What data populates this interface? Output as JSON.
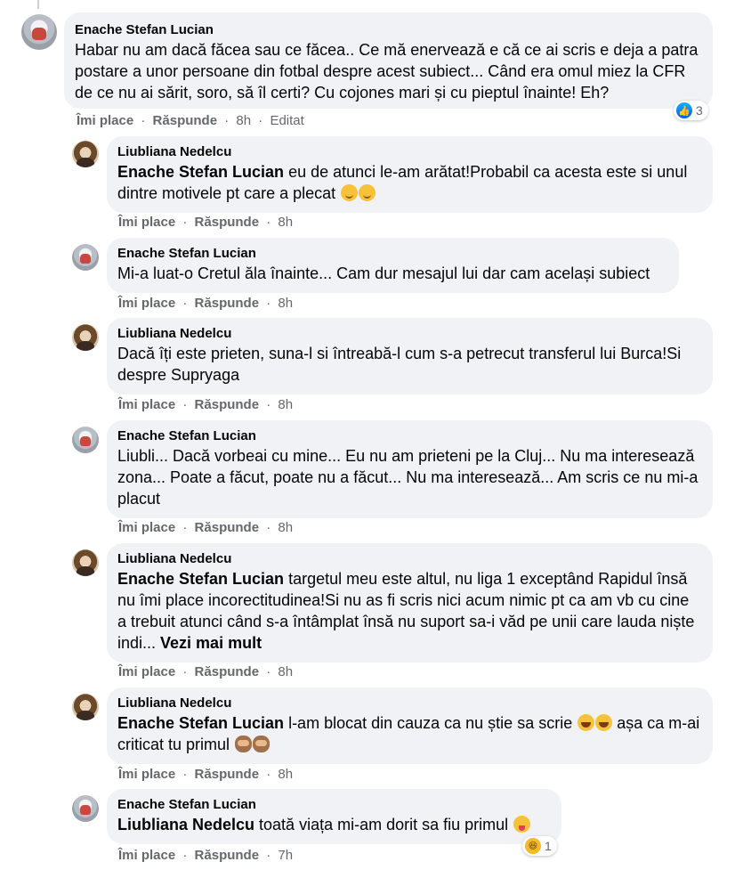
{
  "comments": [
    {
      "author": "Enache Stefan Lucian",
      "text": "Habar nu am dacă făcea sau ce făcea.. Ce mă enervează e că ce ai scris e deja a patra postare a unor persoane din fotbal despre acest subiect... Când era omul miez la CFR de ce nu ai sărit, soro, să îl certi? Cu cojones mari și cu pieptul înainte! Eh?",
      "like": "Îmi place",
      "reply": "Răspunde",
      "time": "8h",
      "edited": "Editat",
      "reaction_count": "3",
      "reaction_icon": "like-icon"
    },
    {
      "author": "Liubliana Nedelcu",
      "tag": "Enache Stefan Lucian",
      "text": " eu de atunci le-am arătat!Probabil ca acesta este si unul dintre motivele pt care a plecat ",
      "emojis": [
        "smirk-emoji",
        "smirk-emoji"
      ],
      "like": "Îmi place",
      "reply": "Răspunde",
      "time": "8h"
    },
    {
      "author": "Enache Stefan Lucian",
      "text": "Mi-a luat-o Cretul ăla înainte... Cam dur mesajul lui dar cam același subiect",
      "like": "Îmi place",
      "reply": "Răspunde",
      "time": "8h"
    },
    {
      "author": "Liubliana Nedelcu",
      "text": "Dacă îți este prieten, suna-l si întreabă-l cum s-a petrecut transferul lui Burca!Si despre Supryaga",
      "like": "Îmi place",
      "reply": "Răspunde",
      "time": "8h"
    },
    {
      "author": "Enache Stefan Lucian",
      "text": "Liubli... Dacă vorbeai cu mine... Eu nu am prieteni pe la Cluj... Nu ma interesează zona... Poate a făcut, poate nu a făcut... Nu ma interesează... Am scris ce nu mi-a placut",
      "like": "Îmi place",
      "reply": "Răspunde",
      "time": "8h"
    },
    {
      "author": "Liubliana Nedelcu",
      "tag": "Enache Stefan Lucian",
      "text": " targetul meu este altul, nu liga 1 exceptând Rapidul însă nu îmi place incorectitudinea!Si nu as fi scris nici acum nimic pt ca am vb cu cine a trebuit atunci când s-a întâmplat însă nu suport sa-i văd pe unii care lauda niște indi... ",
      "see_more": "Vezi mai mult",
      "like": "Îmi place",
      "reply": "Răspunde",
      "time": "8h"
    },
    {
      "author": "Liubliana Nedelcu",
      "tag": "Enache Stefan Lucian",
      "text": " l-am blocat din cauza ca nu știe sa scrie ",
      "text2": " așa ca m-ai criticat tu primul ",
      "like": "Îmi place",
      "reply": "Răspunde",
      "time": "8h"
    },
    {
      "author": "Enache Stefan Lucian",
      "tag": "Liubliana Nedelcu",
      "text": " toată viața mi-am dorit sa fiu primul ",
      "like": "Îmi place",
      "reply": "Răspunde",
      "time": "7h",
      "reaction_count": "1",
      "reaction_icon": "haha-icon"
    }
  ],
  "separator": "·"
}
